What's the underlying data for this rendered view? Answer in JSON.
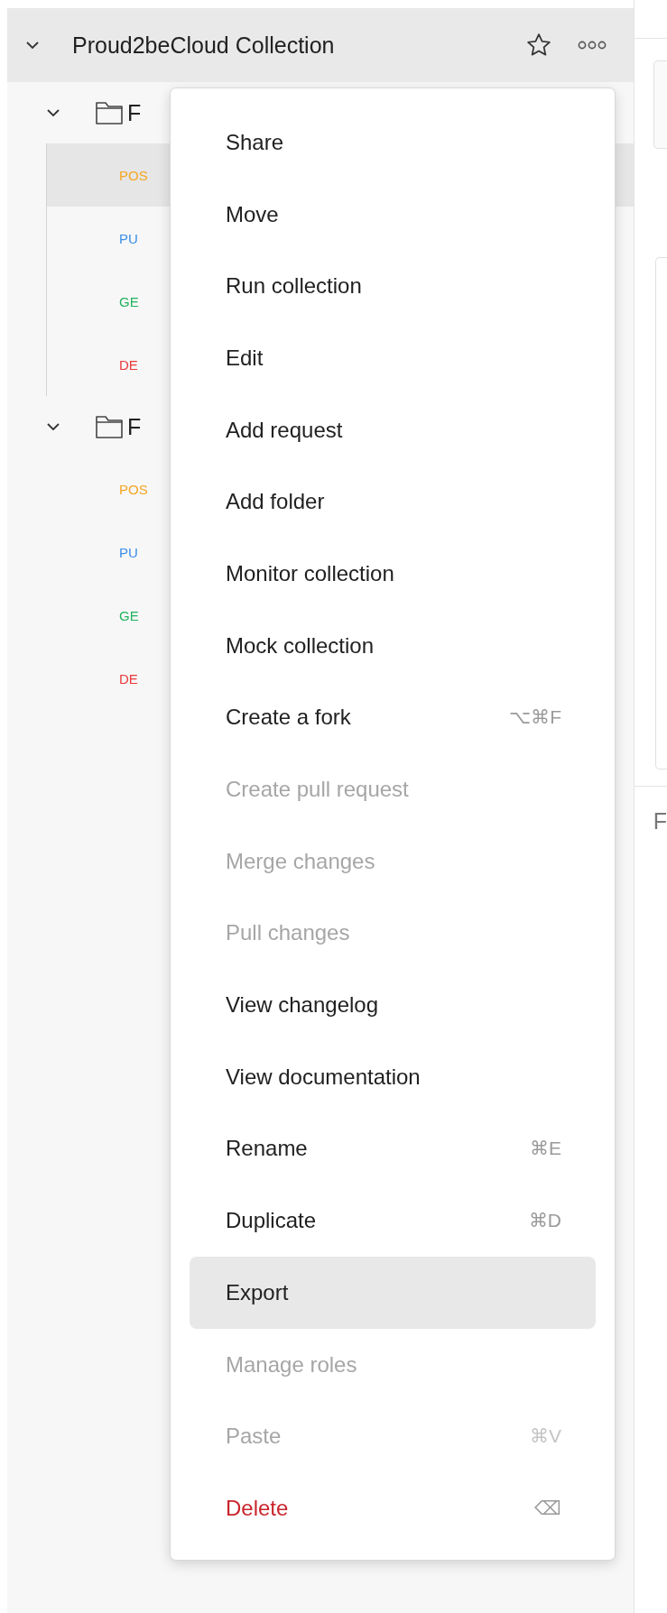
{
  "collection": {
    "name": "Proud2beCloud Collection",
    "expanded": true
  },
  "folders": [
    {
      "name": "F",
      "expanded": true,
      "requests": [
        {
          "method": "POS",
          "color": "#f5a623",
          "selected": true
        },
        {
          "method": "PU",
          "color": "#3a8ee6",
          "selected": false
        },
        {
          "method": "GE",
          "color": "#22b35e",
          "selected": false
        },
        {
          "method": "DE",
          "color": "#eb3b3b",
          "selected": false
        }
      ]
    },
    {
      "name": "F",
      "expanded": true,
      "requests": [
        {
          "method": "POS",
          "color": "#f5a623",
          "selected": false
        },
        {
          "method": "PU",
          "color": "#3a8ee6",
          "selected": false
        },
        {
          "method": "GE",
          "color": "#22b35e",
          "selected": false
        },
        {
          "method": "DE",
          "color": "#eb3b3b",
          "selected": false
        }
      ]
    }
  ],
  "right_pane": {
    "label": "F"
  },
  "menu": [
    {
      "label": "Share",
      "kind": "normal",
      "disabled": false,
      "selected": false
    },
    {
      "label": "Move",
      "kind": "normal",
      "disabled": false,
      "selected": false
    },
    {
      "label": "Run collection",
      "kind": "normal",
      "disabled": false,
      "selected": false
    },
    {
      "label": "Edit",
      "kind": "normal",
      "disabled": false,
      "selected": false
    },
    {
      "label": "Add request",
      "kind": "normal",
      "disabled": false,
      "selected": false
    },
    {
      "label": "Add folder",
      "kind": "normal",
      "disabled": false,
      "selected": false
    },
    {
      "label": "Monitor collection",
      "kind": "normal",
      "disabled": false,
      "selected": false
    },
    {
      "label": "Mock collection",
      "kind": "normal",
      "disabled": false,
      "selected": false
    },
    {
      "label": "Create a fork",
      "shortcut": "⌥⌘F",
      "kind": "normal",
      "disabled": false,
      "selected": false
    },
    {
      "label": "Create pull request",
      "kind": "normal",
      "disabled": true,
      "selected": false
    },
    {
      "label": "Merge changes",
      "kind": "normal",
      "disabled": true,
      "selected": false
    },
    {
      "label": "Pull changes",
      "kind": "normal",
      "disabled": true,
      "selected": false
    },
    {
      "label": "View changelog",
      "kind": "normal",
      "disabled": false,
      "selected": false
    },
    {
      "label": "View documentation",
      "kind": "normal",
      "disabled": false,
      "selected": false
    },
    {
      "label": "Rename",
      "shortcut": "⌘E",
      "kind": "normal",
      "disabled": false,
      "selected": false
    },
    {
      "label": "Duplicate",
      "shortcut": "⌘D",
      "kind": "normal",
      "disabled": false,
      "selected": false
    },
    {
      "label": "Export",
      "kind": "normal",
      "disabled": false,
      "selected": true
    },
    {
      "label": "Manage roles",
      "kind": "normal",
      "disabled": true,
      "selected": false
    },
    {
      "label": "Paste",
      "shortcut": "⌘V",
      "kind": "normal",
      "disabled": true,
      "selected": false
    },
    {
      "label": "Delete",
      "shortcut": "⌫",
      "kind": "danger",
      "disabled": false,
      "selected": false
    }
  ]
}
